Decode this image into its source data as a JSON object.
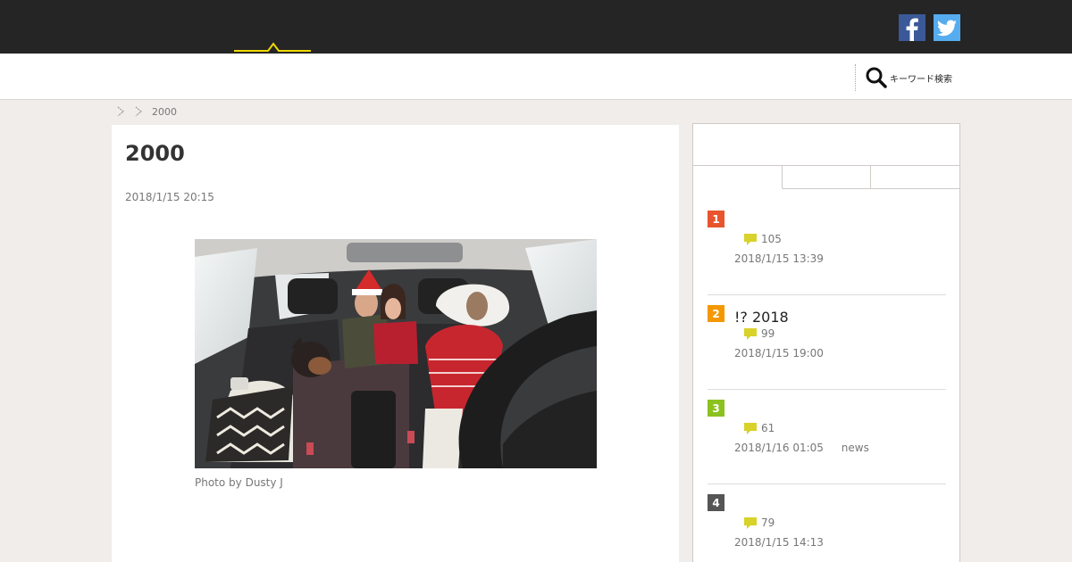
{
  "header": {
    "social": [
      {
        "name": "facebook",
        "icon": "facebook-icon",
        "color": "#3b5998"
      },
      {
        "name": "twitter",
        "icon": "twitter-icon",
        "color": "#55acee"
      }
    ]
  },
  "nav": {
    "search_label": "キーワード検索",
    "search_icon": "search-icon"
  },
  "breadcrumb": {
    "current": "2000"
  },
  "article": {
    "title": "2000",
    "date": "2018/1/15 20:15",
    "photo_caption": "Photo by Dusty J"
  },
  "sidebar": {
    "ranking": [
      {
        "rank": "1",
        "color": "#e8542e",
        "title": "",
        "comments": "105",
        "date": "2018/1/15 13:39",
        "tag": ""
      },
      {
        "rank": "2",
        "color": "#f39800",
        "title": "!? 2018",
        "comments": "99",
        "date": "2018/1/15 19:00",
        "tag": ""
      },
      {
        "rank": "3",
        "color": "#8cc21f",
        "title": "",
        "comments": "61",
        "date": "2018/1/16 01:05",
        "tag": "news"
      },
      {
        "rank": "4",
        "color": "#555555",
        "title": "",
        "comments": "79",
        "date": "2018/1/15 14:13",
        "tag": ""
      }
    ]
  },
  "colors": {
    "topbar": "#252525",
    "accent": "#f0d800",
    "comment_icon": "#d8d22a"
  }
}
